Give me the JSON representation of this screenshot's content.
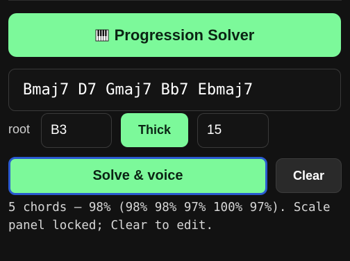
{
  "header": {
    "title": "Progression Solver",
    "icon": "piano-icon"
  },
  "chords": {
    "value": "Bmaj7 D7 Gmaj7 Bb7 Ebmaj7"
  },
  "options": {
    "root_label": "root",
    "root_value": "B3",
    "thick_label": "Thick",
    "count_value": "15"
  },
  "actions": {
    "solve_label": "Solve & voice",
    "clear_label": "Clear"
  },
  "status": {
    "text": "5 chords — 98% (98% 98% 97% 100% 97%). Scale panel locked; Clear to edit."
  },
  "colors": {
    "accent": "#7cf99a",
    "focus_ring": "#2a5bd0",
    "background": "#121212"
  }
}
